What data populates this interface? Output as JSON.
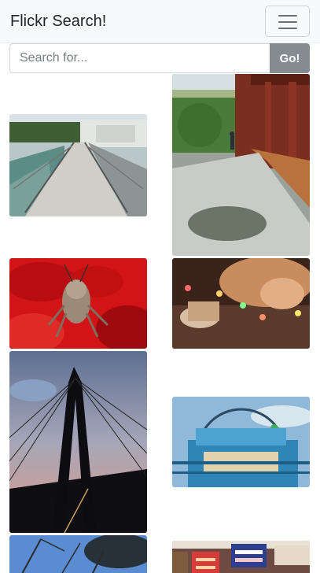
{
  "navbar": {
    "brand": "Flickr Search!",
    "toggle_icon": "hamburger-menu-icon"
  },
  "search": {
    "placeholder": "Search for...",
    "value": "",
    "button_label": "Go!"
  },
  "results": {
    "photos": [
      {
        "subject": "bridge walkway"
      },
      {
        "subject": "temple veranda with person"
      },
      {
        "subject": "grasshopper on red flower"
      },
      {
        "subject": "dog with string lights"
      },
      {
        "subject": "cable-stayed bridge pylon"
      },
      {
        "subject": "ferris wheel"
      },
      {
        "subject": "tree against sky"
      },
      {
        "subject": "shop signs"
      }
    ]
  }
}
